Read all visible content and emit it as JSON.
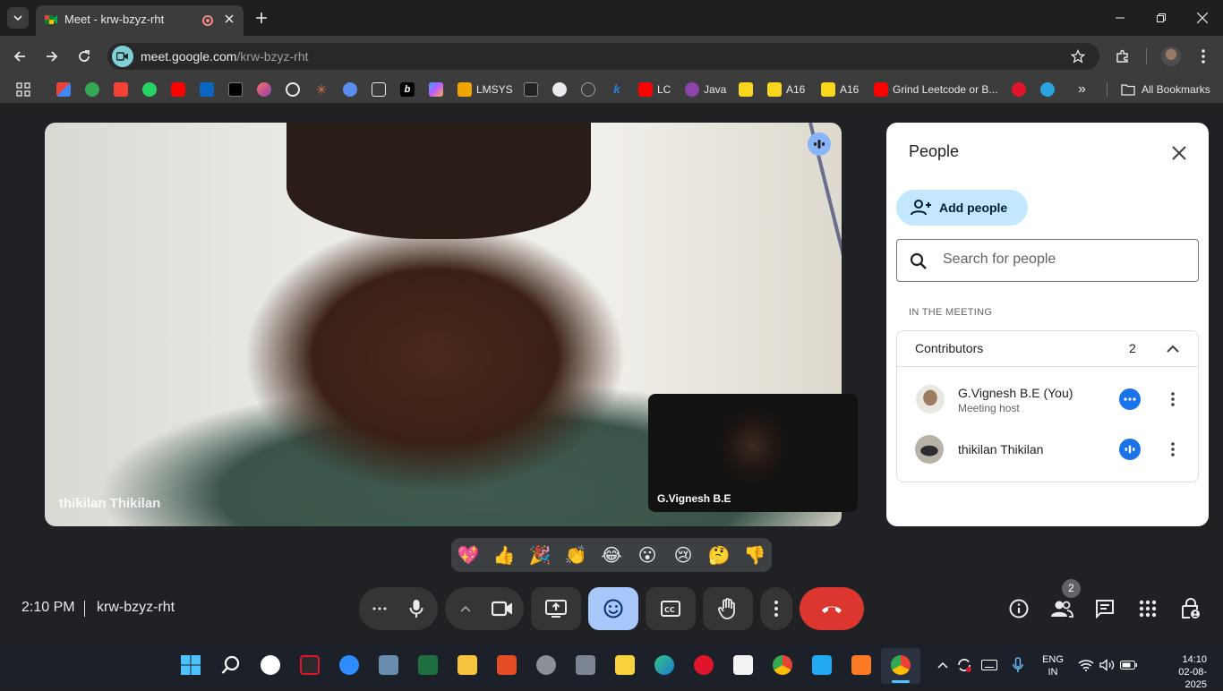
{
  "browser": {
    "tab_title": "Meet - krw-bzyz-rht",
    "url_host": "meet.google.com",
    "url_path": "/krw-bzyz-rht"
  },
  "bookmarks": [
    {
      "label": "LMSYS"
    },
    {
      "label": "LC"
    },
    {
      "label": "Java"
    },
    {
      "label": "A16"
    },
    {
      "label": "A16"
    },
    {
      "label": "Grind Leetcode or B..."
    },
    {
      "label": "All Bookmarks"
    }
  ],
  "main_video": {
    "participant_name": "thikilan Thikilan"
  },
  "self_video": {
    "participant_name": "G.Vignesh B.E"
  },
  "people_panel": {
    "title": "People",
    "add_people_label": "Add people",
    "search_placeholder": "Search for people",
    "section_label": "IN THE MEETING",
    "contributors_label": "Contributors",
    "contributors_count": "2",
    "participants": [
      {
        "name": "G.Vignesh B.E (You)",
        "role": "Meeting host"
      },
      {
        "name": "thikilan Thikilan",
        "role": ""
      }
    ]
  },
  "reactions": [
    "💖",
    "👍",
    "🎉",
    "👏",
    "😂",
    "😮",
    "😢",
    "🤔",
    "👎"
  ],
  "meeting": {
    "time": "2:10 PM",
    "code": "krw-bzyz-rht",
    "people_count": "2"
  },
  "taskbar": {
    "lang_top": "ENG",
    "lang_bottom": "IN",
    "time": "14:10",
    "date": "02-08-2025"
  },
  "colors": {
    "end_call": "#d93025",
    "active_control": "#a8c7fa",
    "accent": "#1a73e8"
  }
}
